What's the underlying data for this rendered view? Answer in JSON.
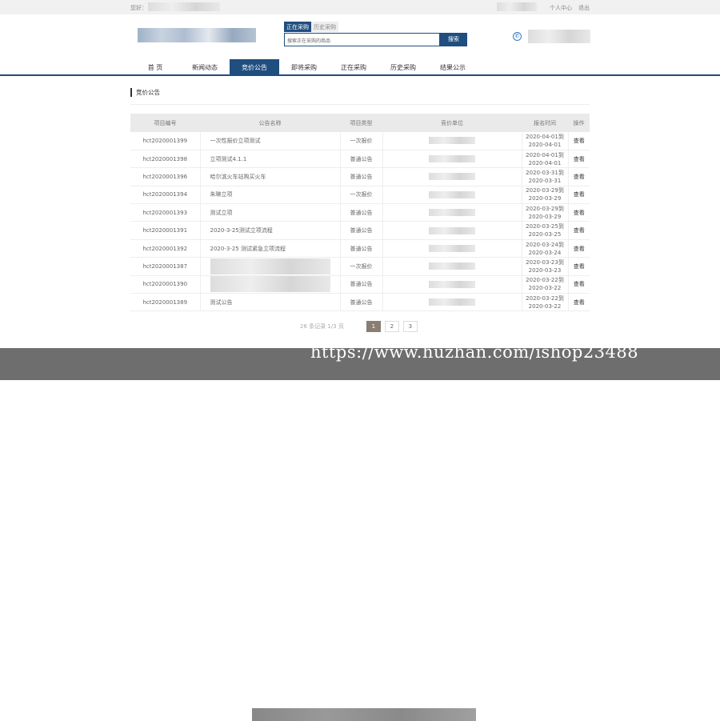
{
  "topbar": {
    "greeting": "您好：",
    "personal_center": "个人中心",
    "logout": "退出"
  },
  "search": {
    "tabs": [
      "正在采购",
      "历史采购"
    ],
    "placeholder": "搜索正在采购的商品",
    "button": "搜索"
  },
  "nav": [
    "首 页",
    "新闻动态",
    "竞价公告",
    "即将采购",
    "正在采购",
    "历史采购",
    "结果公示"
  ],
  "section_title": "竞价公告",
  "table": {
    "headers": [
      "项目编号",
      "公告名称",
      "项目类型",
      "竞价单位",
      "报名时间",
      "操作"
    ],
    "rows": [
      [
        "hct2020001399",
        "一次性报价立项测试",
        "一次报价",
        "2020-04-01到",
        "2020-04-01",
        "查看"
      ],
      [
        "hct2020001398",
        "立项测试4.1.1",
        "普通公告",
        "2020-04-01到",
        "2020-04-01",
        "查看"
      ],
      [
        "hct2020001396",
        "哈尔滨火车站购买火车",
        "普通公告",
        "2020-03-31到",
        "2020-03-31",
        "查看"
      ],
      [
        "hct2020001394",
        "朱琳立项",
        "一次报价",
        "2020-03-29到",
        "2020-03-29",
        "查看"
      ],
      [
        "hct2020001393",
        "测试立项",
        "普通公告",
        "2020-03-29到",
        "2020-03-29",
        "查看"
      ],
      [
        "hct2020001391",
        "2020-3-25测试立项流程",
        "普通公告",
        "2020-03-25到",
        "2020-03-25",
        "查看"
      ],
      [
        "hct2020001392",
        "2020-3-25 测试紧急立项流程",
        "普通公告",
        "2020-03-24到",
        "2020-03-24",
        "查看"
      ],
      [
        "hct2020001387",
        "",
        "一次报价",
        "2020-03-23到",
        "2020-03-23",
        "查看"
      ],
      [
        "hct2020001390",
        "",
        "普通公告",
        "2020-03-22到",
        "2020-03-22",
        "查看"
      ],
      [
        "hct2020001389",
        "测试公告",
        "普通公告",
        "2020-03-22到",
        "2020-03-22",
        "查看"
      ]
    ]
  },
  "pager": {
    "info": "26 条记录 1/3 页",
    "pages": [
      "1",
      "2",
      "3"
    ]
  },
  "watermark": "https://www.huzhan.com/ishop23488"
}
